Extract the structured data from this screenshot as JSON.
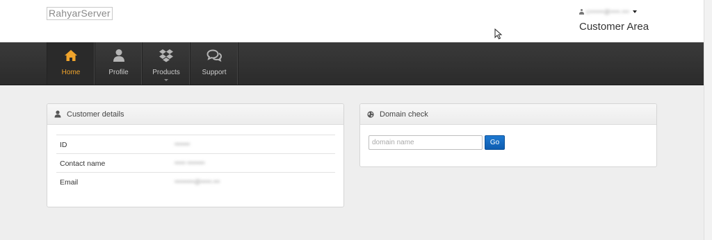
{
  "header": {
    "logo": "RahyarServer",
    "user_email": "c••••••@••••.•••",
    "customer_area": "Customer Area"
  },
  "nav": {
    "items": [
      {
        "label": "Home",
        "icon": "home-icon",
        "active": true
      },
      {
        "label": "Profile",
        "icon": "user-icon"
      },
      {
        "label": "Products",
        "icon": "dropbox-icon",
        "has_submenu": true
      },
      {
        "label": "Support",
        "icon": "chat-bubbles-icon"
      }
    ]
  },
  "customer_details": {
    "title": "Customer details",
    "rows": [
      {
        "label": "ID",
        "value": "•••••••"
      },
      {
        "label": "Contact name",
        "value": "••••• ••••••••"
      },
      {
        "label": "Email",
        "value": "•••••••••@•••••.•••"
      }
    ]
  },
  "domain_check": {
    "title": "Domain check",
    "placeholder": "domain name",
    "button": "Go"
  },
  "colors": {
    "accent_active": "#f0a42c",
    "navbar": "#333333",
    "go_button": "#1466bf"
  }
}
